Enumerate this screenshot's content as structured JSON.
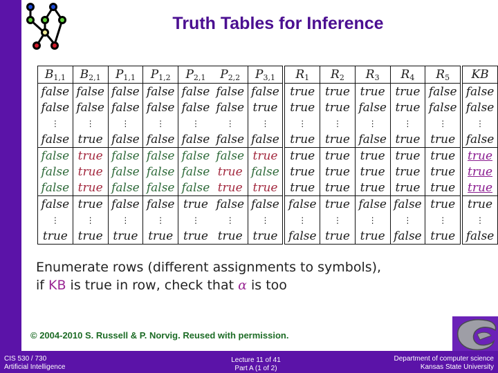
{
  "slide": {
    "title": "Truth Tables for Inference",
    "logo_icon": "graph-network-icon",
    "colors": {
      "theme_purple": "#5b13a8",
      "title_purple": "#4b0f91",
      "copyright_green": "#1c6b25",
      "value_green": "#2f6a3a",
      "value_red": "#a3293f",
      "kb_purple": "#8a1b8f"
    }
  },
  "table": {
    "headers": [
      {
        "base": "B",
        "sub": "1,1"
      },
      {
        "base": "B",
        "sub": "2,1"
      },
      {
        "base": "P",
        "sub": "1,1"
      },
      {
        "base": "P",
        "sub": "1,2"
      },
      {
        "base": "P",
        "sub": "2,1"
      },
      {
        "base": "P",
        "sub": "2,2"
      },
      {
        "base": "P",
        "sub": "3,1"
      },
      {
        "base": "R",
        "sub": "1"
      },
      {
        "base": "R",
        "sub": "2"
      },
      {
        "base": "R",
        "sub": "3"
      },
      {
        "base": "R",
        "sub": "4"
      },
      {
        "base": "R",
        "sub": "5"
      },
      {
        "base": "KB",
        "sub": ""
      }
    ],
    "groups": [
      {
        "rows": [
          [
            "false",
            "false",
            "false",
            "false",
            "false",
            "false",
            "false",
            "true",
            "true",
            "true",
            "true",
            "false",
            "false"
          ],
          [
            "false",
            "false",
            "false",
            "false",
            "false",
            "false",
            "true",
            "true",
            "true",
            "false",
            "true",
            "false",
            "false"
          ],
          [
            "⋮",
            "⋮",
            "⋮",
            "⋮",
            "⋮",
            "⋮",
            "⋮",
            "⋮",
            "⋮",
            "⋮",
            "⋮",
            "⋮",
            "⋮"
          ],
          [
            "false",
            "true",
            "false",
            "false",
            "false",
            "false",
            "false",
            "true",
            "true",
            "false",
            "true",
            "true",
            "false"
          ]
        ]
      },
      {
        "highlight": true,
        "rows": [
          [
            "false",
            "true",
            "false",
            "false",
            "false",
            "false",
            "true",
            "true",
            "true",
            "true",
            "true",
            "true",
            "true"
          ],
          [
            "false",
            "true",
            "false",
            "false",
            "false",
            "true",
            "false",
            "true",
            "true",
            "true",
            "true",
            "true",
            "true"
          ],
          [
            "false",
            "true",
            "false",
            "false",
            "false",
            "true",
            "true",
            "true",
            "true",
            "true",
            "true",
            "true",
            "true"
          ]
        ]
      },
      {
        "rows": [
          [
            "false",
            "true",
            "false",
            "false",
            "true",
            "false",
            "false",
            "false",
            "true",
            "false",
            "false",
            "true",
            "true",
            "false"
          ],
          [
            "⋮",
            "⋮",
            "⋮",
            "⋮",
            "⋮",
            "⋮",
            "⋮",
            "⋮",
            "⋮",
            "⋮",
            "⋮",
            "⋮",
            "⋮"
          ],
          [
            "true",
            "true",
            "true",
            "true",
            "true",
            "true",
            "true",
            "false",
            "true",
            "true",
            "false",
            "true",
            "false"
          ]
        ]
      }
    ]
  },
  "explanation": {
    "line1": "Enumerate rows (different assignments to symbols),",
    "line2_prefix": "if ",
    "line2_kb": "KB",
    "line2_mid": " is true in row, check that ",
    "line2_alpha": "α",
    "line2_suffix": " is too"
  },
  "copyright": "© 2004-2010 S. Russell & P. Norvig.  Reused with permission.",
  "footer": {
    "left_line1": "CIS 530 / 730",
    "left_line2": "Artificial Intelligence",
    "center_line1": "Lecture 11 of 41",
    "center_line2": "Part A (1 of 2)",
    "right_line1": "Department of computer science",
    "right_line2": "Kansas State University",
    "logo_icon": "wildcat-icon"
  }
}
